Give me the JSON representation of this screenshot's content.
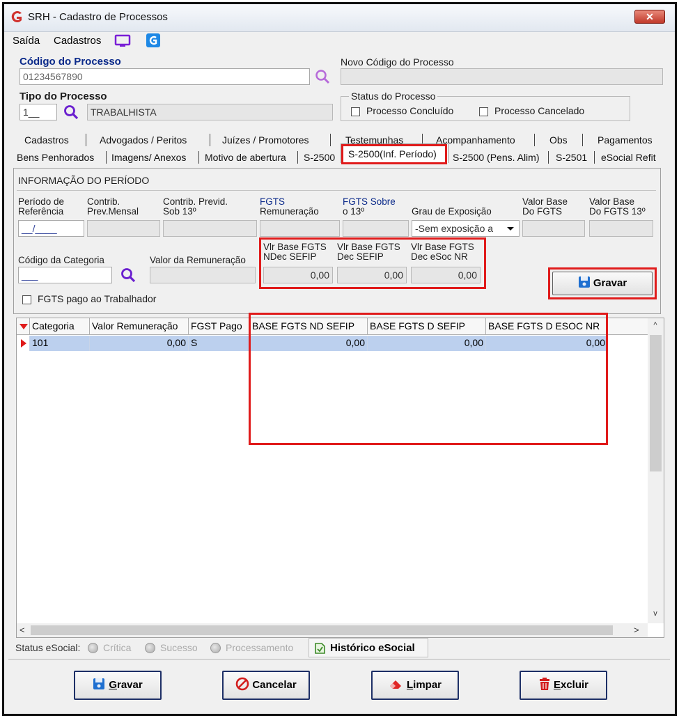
{
  "window": {
    "title": "SRH - Cadastro de Processos",
    "close_glyph": "✕"
  },
  "menu": {
    "items": [
      "Saída",
      "Cadastros"
    ]
  },
  "header": {
    "codigo_label": "Código do Processo",
    "codigo_value": "01234567890",
    "novo_codigo_label": "Novo Código do Processo",
    "novo_codigo_value": "",
    "tipo_label": "Tipo do Processo",
    "tipo_code": "1__",
    "tipo_desc": "TRABALHISTA",
    "status_group_label": "Status do Processo",
    "status_concluido": "Processo Concluído",
    "status_cancelado": "Processo Cancelado"
  },
  "tabs": {
    "row1": [
      "Cadastros",
      "Advogados / Peritos",
      "Juízes / Promotores",
      "Testemunhas",
      "Acompanhamento",
      "Obs",
      "Pagamentos"
    ],
    "row2": [
      "Bens Penhorados",
      "Imagens/ Anexos",
      "Motivo de abertura",
      "S-2500",
      "S-2500(Inf. Período)",
      "S-2500 (Pens. Alim)",
      "S-2501",
      "eSocial Refit"
    ],
    "active": "S-2500(Inf. Período)"
  },
  "periodo": {
    "section_title": "INFORMAÇÃO DO PERÍODO",
    "periodo_ref_label": [
      "Período de",
      "Referência"
    ],
    "periodo_ref_value": "__/____",
    "contrib_mensal_label": [
      "Contrib.",
      "Prev.Mensal"
    ],
    "contrib_13_label": [
      "Contrib. Previd.",
      "Sob 13º"
    ],
    "fgts_rem_label": [
      "FGTS",
      "Remuneração"
    ],
    "fgts_13_label": [
      "FGTS Sobre",
      "o 13º"
    ],
    "grau_label": "Grau de Exposição",
    "grau_value": "-Sem exposição a",
    "vb_fgts_label": [
      "Valor Base",
      "Do FGTS"
    ],
    "vb_fgts13_label": [
      "Valor Base",
      "Do FGTS 13º"
    ],
    "cod_cat_label": "Código da Categoria",
    "cod_cat_value": "___",
    "valor_rem_label": "Valor da Remuneração",
    "vlr_nd_label": [
      "Vlr Base FGTS",
      "NDec SEFIP"
    ],
    "vlr_nd_value": "0,00",
    "vlr_d_label": [
      "Vlr Base FGTS",
      "Dec SEFIP"
    ],
    "vlr_d_value": "0,00",
    "vlr_nr_label": [
      "Vlr Base FGTS",
      "Dec eSoc NR"
    ],
    "vlr_nr_value": "0,00",
    "fgts_pago_label": "FGTS pago ao Trabalhador",
    "gravar_label": "Gravar"
  },
  "grid": {
    "columns": [
      "Categoria",
      "Valor Remuneração",
      "FGST Pago",
      "BASE FGTS ND SEFIP",
      "BASE FGTS D SEFIP",
      "BASE FGTS D ESOC NR"
    ],
    "rows": [
      [
        "101",
        "0,00",
        "S",
        "0,00",
        "0,00",
        "0,00"
      ]
    ]
  },
  "status_bar": {
    "label": "Status eSocial:",
    "items": [
      "Crítica",
      "Sucesso",
      "Processamento"
    ],
    "historico_label": "Histórico eSocial"
  },
  "buttons": {
    "gravar": {
      "underline": "G",
      "rest": "ravar"
    },
    "cancelar": "Cancelar",
    "limpar": {
      "underline": "L",
      "rest": "impar"
    },
    "excluir": {
      "underline": "E",
      "rest": "xcluir"
    }
  },
  "colors": {
    "highlight_red": "#e01b1b",
    "label_blue": "#0b2a8a",
    "selected_row": "#bcd0ee",
    "search_purple": "#7a2fd0"
  }
}
